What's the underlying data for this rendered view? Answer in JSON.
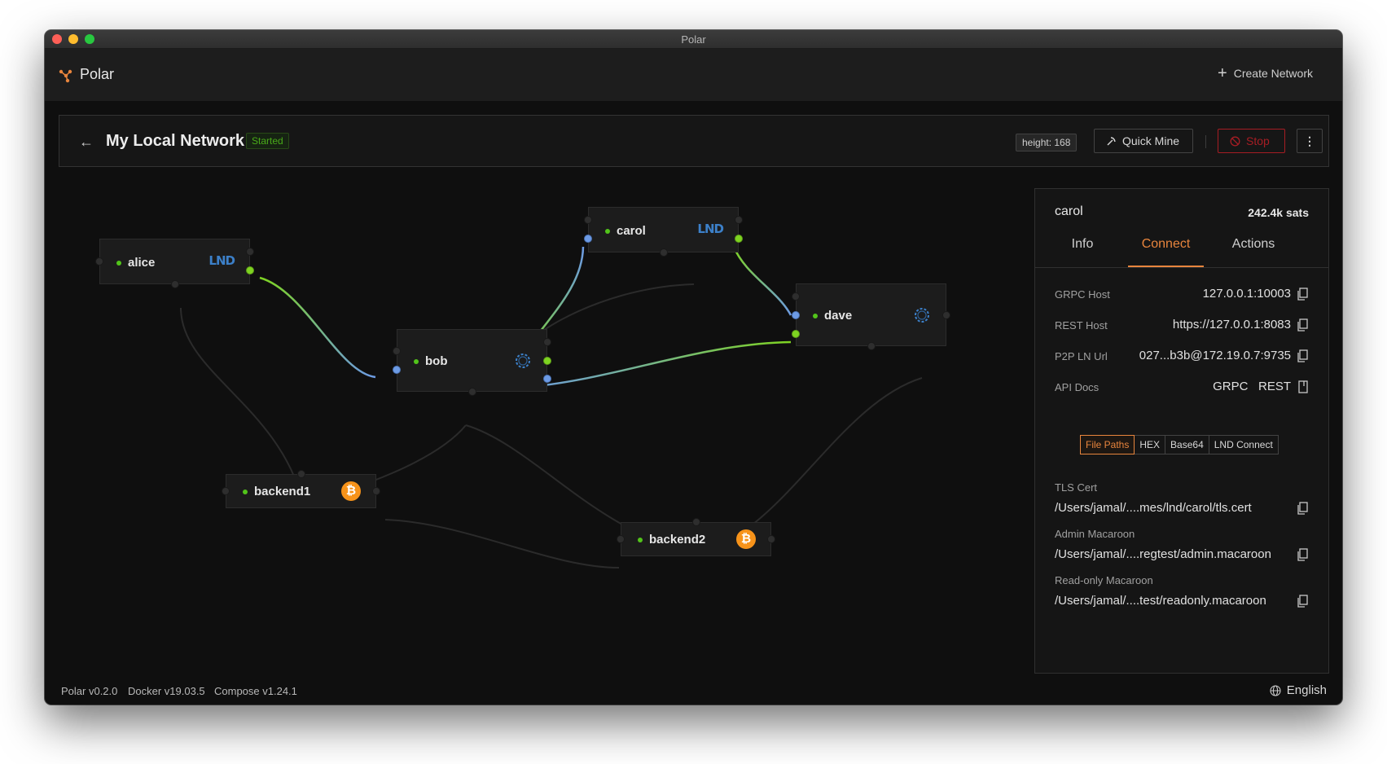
{
  "window": {
    "title": "Polar"
  },
  "app": {
    "name": "Polar",
    "create_label": "Create Network"
  },
  "network": {
    "name": "My Local Network",
    "status": "Started",
    "height": "height: 168",
    "quick_mine_label": "Quick Mine",
    "stop_label": "Stop"
  },
  "nodes": {
    "alice": {
      "name": "alice",
      "impl": "LND"
    },
    "bob": {
      "name": "bob",
      "impl": "c-lightning"
    },
    "carol": {
      "name": "carol",
      "impl": "LND"
    },
    "dave": {
      "name": "dave",
      "impl": "c-lightning"
    },
    "backend1": {
      "name": "backend1",
      "impl": "bitcoind",
      "symbol": "₿"
    },
    "backend2": {
      "name": "backend2",
      "impl": "bitcoind",
      "symbol": "₿"
    }
  },
  "sidebar": {
    "node_name": "carol",
    "balance": "242.4k sats",
    "tabs": [
      "Info",
      "Connect",
      "Actions"
    ],
    "active_tab": "Connect",
    "grpc_host": {
      "label": "GRPC Host",
      "value": "127.0.0.1:10003"
    },
    "rest_host": {
      "label": "REST Host",
      "value": "https://127.0.0.1:8083"
    },
    "p2p_url": {
      "label": "P2P LN Url",
      "value": "027...b3b@172.19.0.7:9735"
    },
    "api_docs": {
      "label": "API Docs",
      "grpc": "GRPC",
      "rest": "REST"
    },
    "formats": [
      "File Paths",
      "HEX",
      "Base64",
      "LND Connect"
    ],
    "active_format": "File Paths",
    "tls_cert": {
      "label": "TLS Cert",
      "value": "/Users/jamal/....mes/lnd/carol/tls.cert"
    },
    "admin_macaroon": {
      "label": "Admin Macaroon",
      "value": "/Users/jamal/....regtest/admin.macaroon"
    },
    "readonly_macaroon": {
      "label": "Read-only Macaroon",
      "value": "/Users/jamal/....test/readonly.macaroon"
    }
  },
  "footer": {
    "polar_version": "Polar v0.2.0",
    "docker_version": "Docker v19.03.5",
    "compose_version": "Compose v1.24.1",
    "language": "English"
  },
  "colors": {
    "accent": "#e8853d",
    "channel_green": "#7ed321",
    "channel_blue": "#6d9be5",
    "stop_red": "#a61d24",
    "started_green": "#49aa19",
    "bitcoin_orange": "#f7931a"
  }
}
